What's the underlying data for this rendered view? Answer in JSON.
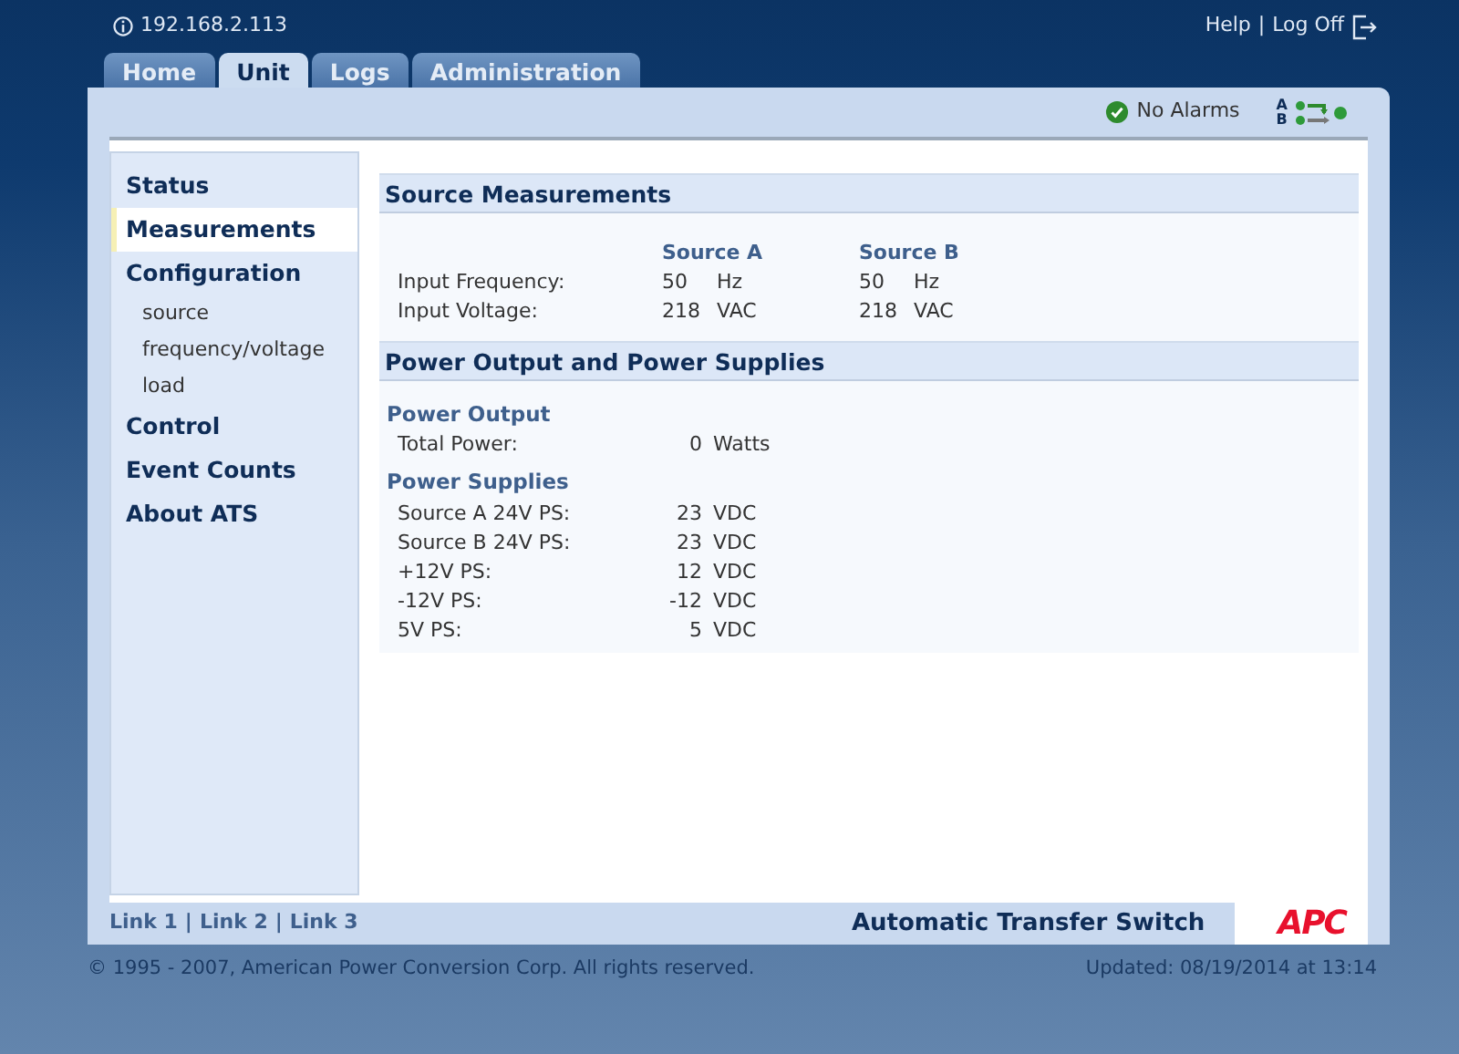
{
  "top_bar": {
    "address": "192.168.2.113",
    "links": [
      "Help",
      "Log Off"
    ],
    "separator": "|"
  },
  "tabs": [
    {
      "label": "Home",
      "selected": false
    },
    {
      "label": "Unit",
      "selected": true
    },
    {
      "label": "Logs",
      "selected": false
    },
    {
      "label": "Administration",
      "selected": false
    }
  ],
  "status": {
    "alarm_text": "No Alarms",
    "sources": [
      "A",
      "B"
    ]
  },
  "sidebar": {
    "items": [
      {
        "label": "Status",
        "kind": "main",
        "selected": false
      },
      {
        "label": "Measurements",
        "kind": "main",
        "selected": true
      },
      {
        "label": "Configuration",
        "kind": "main",
        "selected": false
      },
      {
        "label": "source",
        "kind": "sub",
        "selected": false
      },
      {
        "label": "frequency/voltage",
        "kind": "sub",
        "selected": false
      },
      {
        "label": "load",
        "kind": "sub",
        "selected": false
      },
      {
        "label": "Control",
        "kind": "main",
        "selected": false
      },
      {
        "label": "Event Counts",
        "kind": "main",
        "selected": false
      },
      {
        "label": "About ATS",
        "kind": "main",
        "selected": false
      }
    ]
  },
  "source_measurements": {
    "title": "Source Measurements",
    "columns": [
      "Source A",
      "Source B"
    ],
    "rows": [
      {
        "label": "Input Frequency:",
        "values": [
          {
            "value": "50",
            "unit": "Hz"
          },
          {
            "value": "50",
            "unit": "Hz"
          }
        ]
      },
      {
        "label": "Input Voltage:",
        "values": [
          {
            "value": "218",
            "unit": "VAC"
          },
          {
            "value": "218",
            "unit": "VAC"
          }
        ]
      }
    ]
  },
  "power": {
    "title": "Power Output and Power Supplies",
    "groups": [
      {
        "title": "Power Output",
        "rows": [
          {
            "label": "Total Power:",
            "value": "0",
            "unit": "Watts"
          }
        ]
      },
      {
        "title": "Power Supplies",
        "rows": [
          {
            "label": "Source A 24V PS:",
            "value": "23",
            "unit": "VDC"
          },
          {
            "label": "Source B 24V PS:",
            "value": "23",
            "unit": "VDC"
          },
          {
            "label": "+12V PS:",
            "value": "12",
            "unit": "VDC"
          },
          {
            "label": "-12V PS:",
            "value": "-12",
            "unit": "VDC"
          },
          {
            "label": "5V PS:",
            "value": "5",
            "unit": "VDC"
          }
        ]
      }
    ]
  },
  "footer": {
    "links": [
      "Link 1",
      "Link 2",
      "Link 3"
    ],
    "separator": "|",
    "product": "Automatic Transfer Switch",
    "logo": "APC"
  },
  "copyright": "© 1995 - 2007, American Power Conversion Corp. All rights reserved.",
  "updated": "Updated: 08/19/2014 at 13:14"
}
